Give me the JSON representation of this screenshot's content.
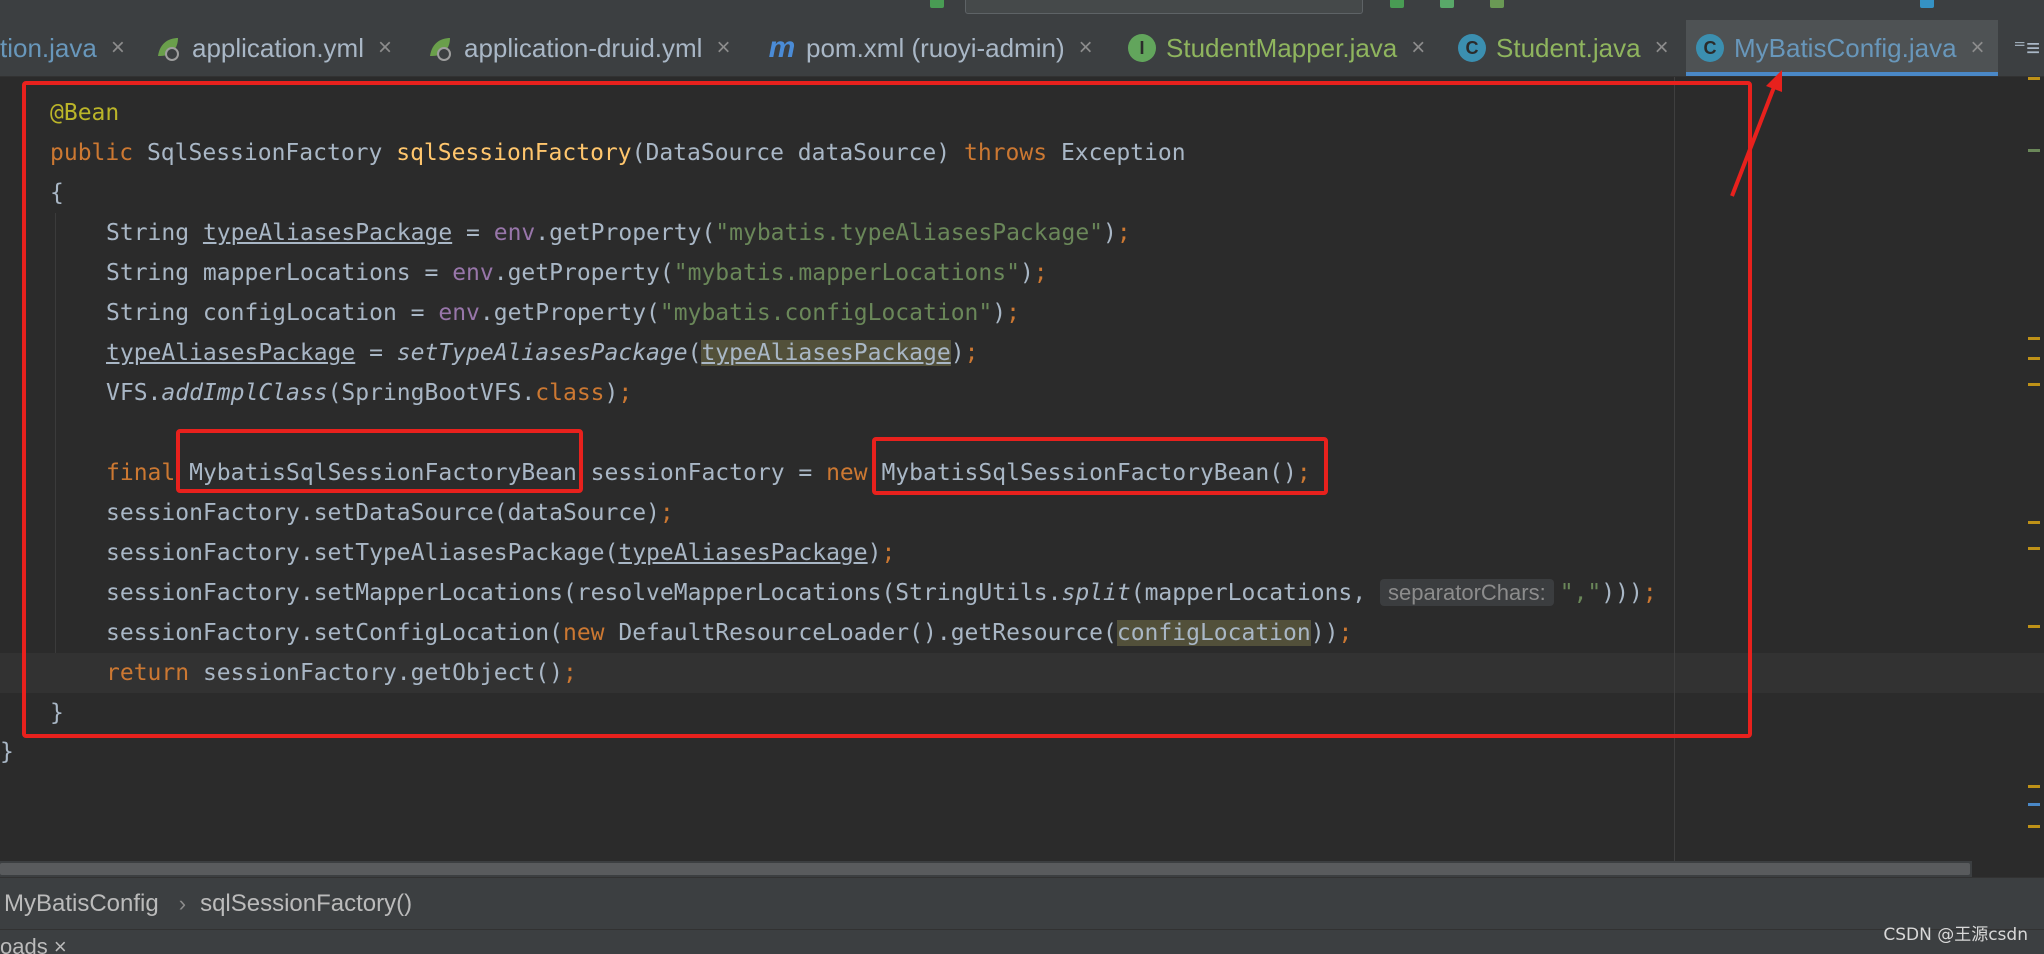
{
  "tabs": [
    {
      "label": "tion.java",
      "icon": "none",
      "kind": "java"
    },
    {
      "label": "application.yml",
      "icon": "spring-yml-icon",
      "kind": "yml"
    },
    {
      "label": "application-druid.yml",
      "icon": "spring-yml-icon",
      "kind": "yml"
    },
    {
      "label": "pom.xml (ruoyi-admin)",
      "icon": "maven-icon",
      "kind": "maven"
    },
    {
      "label": "StudentMapper.java",
      "icon": "interface-icon",
      "kind": "interface"
    },
    {
      "label": "Student.java",
      "icon": "class-icon",
      "kind": "class"
    },
    {
      "label": "MyBatisConfig.java",
      "icon": "class-icon",
      "kind": "class",
      "active": true
    }
  ],
  "tab_icon_letters": {
    "maven": "m",
    "interface": "I",
    "class": "C"
  },
  "close_glyph": "×",
  "overflow_glyph": "⁼≡",
  "code": {
    "annotation": "@Bean",
    "signature": {
      "kw_public": "public",
      "return_type": "SqlSessionFactory",
      "method": "sqlSessionFactory",
      "params": "(DataSource dataSource)",
      "kw_throws": "throws",
      "exception": "Exception"
    },
    "open_brace": "{",
    "close_brace": "}",
    "outer_close": "}",
    "l1": {
      "type": "String ",
      "var": "typeAliasesPackage",
      "mid": " = ",
      "env": "env",
      "call": ".getProperty(",
      "str": "\"mybatis.typeAliasesPackage\"",
      "end": ")",
      "semi": ";"
    },
    "l2": {
      "type": "String mapperLocations = ",
      "env": "env",
      "call": ".getProperty(",
      "str": "\"mybatis.mapperLocations\"",
      "end": ")",
      "semi": ";"
    },
    "l3": {
      "type": "String configLocation = ",
      "env": "env",
      "call": ".getProperty(",
      "str": "\"mybatis.configLocation\"",
      "end": ")",
      "semi": ";"
    },
    "l4": {
      "var": "typeAliasesPackage",
      "mid": " = ",
      "call": "setTypeAliasesPackage",
      "open": "(",
      "arg": "typeAliasesPackage",
      "close": ")",
      "semi": ";"
    },
    "l5": {
      "cls": "VFS.",
      "call": "addImplClass",
      "arg": "(SpringBootVFS.",
      "kw": "class",
      "close": ")",
      "semi": ";"
    },
    "l6": {
      "kw_final": "final ",
      "type": "MybatisSqlSessionFactoryBean",
      "var": " sessionFactory = ",
      "kw_new": "new ",
      "ctor": "MybatisSqlSessionFactoryBean()",
      "semi": ";"
    },
    "l7": {
      "text": "sessionFactory.setDataSource(dataSource)",
      "semi": ";"
    },
    "l8": {
      "pre": "sessionFactory.setTypeAliasesPackage(",
      "var": "typeAliasesPackage",
      "close": ")",
      "semi": ";"
    },
    "l9": {
      "pre": "sessionFactory.setMapperLocations(resolveMapperLocations(StringUtils.",
      "call": "split",
      "arg": "(mapperLocations, ",
      "hint": "separatorChars:",
      "str": "\",\"",
      "close": ")))",
      "semi": ";"
    },
    "l10": {
      "pre": "sessionFactory.setConfigLocation(",
      "kw_new": "new ",
      "mid": "DefaultResourceLoader().getResource(",
      "arg": "configLocation",
      "close": "))",
      "semi": ";"
    },
    "l11": {
      "kw_return": "return ",
      "text": "sessionFactory.getObject()",
      "semi": ";"
    }
  },
  "breadcrumb": {
    "class_name": "MyBatisConfig",
    "separator": "›",
    "method_name": "sqlSessionFactory()"
  },
  "bottom_panel": {
    "label": "oads ×"
  },
  "watermark": "CSDN @王源csdn",
  "colors": {
    "annotation_red": "#e8211d",
    "active_tab_accent": "#4a88c7"
  }
}
